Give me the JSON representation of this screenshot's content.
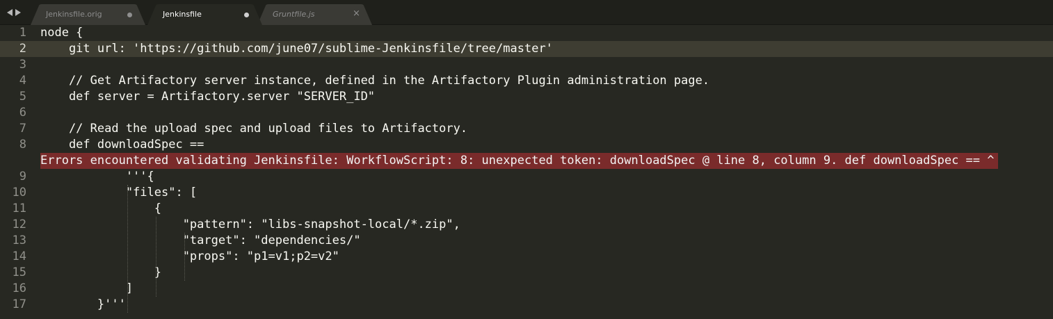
{
  "tabs": [
    {
      "label": "Jenkinsfile.orig",
      "state": "modified",
      "active": false,
      "italic": false
    },
    {
      "label": "Jenkinsfile",
      "state": "modified",
      "active": true,
      "italic": false
    },
    {
      "label": "Gruntfile.js",
      "state": "close",
      "active": false,
      "italic": true
    }
  ],
  "tab_close_glyph": "×",
  "nav": {
    "back_icon": "triangle-left-icon",
    "forward_icon": "triangle-right-icon"
  },
  "editor": {
    "current_line": 2,
    "lines": [
      {
        "num": "1",
        "text": "node {"
      },
      {
        "num": "2",
        "text": "    git url: 'https://github.com/june07/sublime-Jenkinsfile/tree/master'"
      },
      {
        "num": "3",
        "text": ""
      },
      {
        "num": "4",
        "text": "    // Get Artifactory server instance, defined in the Artifactory Plugin administration page."
      },
      {
        "num": "5",
        "text": "    def server = Artifactory.server \"SERVER_ID\""
      },
      {
        "num": "6",
        "text": ""
      },
      {
        "num": "7",
        "text": "    // Read the upload spec and upload files to Artifactory."
      },
      {
        "num": "8",
        "text": "    def downloadSpec =="
      },
      {
        "num": "",
        "text": "Errors encountered validating Jenkinsfile: WorkflowScript: 8: unexpected token: downloadSpec @ line 8, column 9. def downloadSpec == ^",
        "error": true
      },
      {
        "num": "9",
        "text": "            '''{"
      },
      {
        "num": "10",
        "text": "            \"files\": ["
      },
      {
        "num": "11",
        "text": "                {"
      },
      {
        "num": "12",
        "text": "                    \"pattern\": \"libs-snapshot-local/*.zip\","
      },
      {
        "num": "13",
        "text": "                    \"target\": \"dependencies/\""
      },
      {
        "num": "14",
        "text": "                    \"props\": \"p1=v1;p2=v2\""
      },
      {
        "num": "15",
        "text": "                }"
      },
      {
        "num": "16",
        "text": "            ]"
      },
      {
        "num": "17",
        "text": "        }'''"
      }
    ]
  },
  "colors": {
    "background": "#272822",
    "tabbar": "#1f201b",
    "active_tab": "#272822",
    "inactive_tab": "#3a3a35",
    "current_line": "#3e3d32",
    "error_bg": "#7a2b2b",
    "text": "#f8f8f2",
    "gutter_text": "#90908a"
  }
}
